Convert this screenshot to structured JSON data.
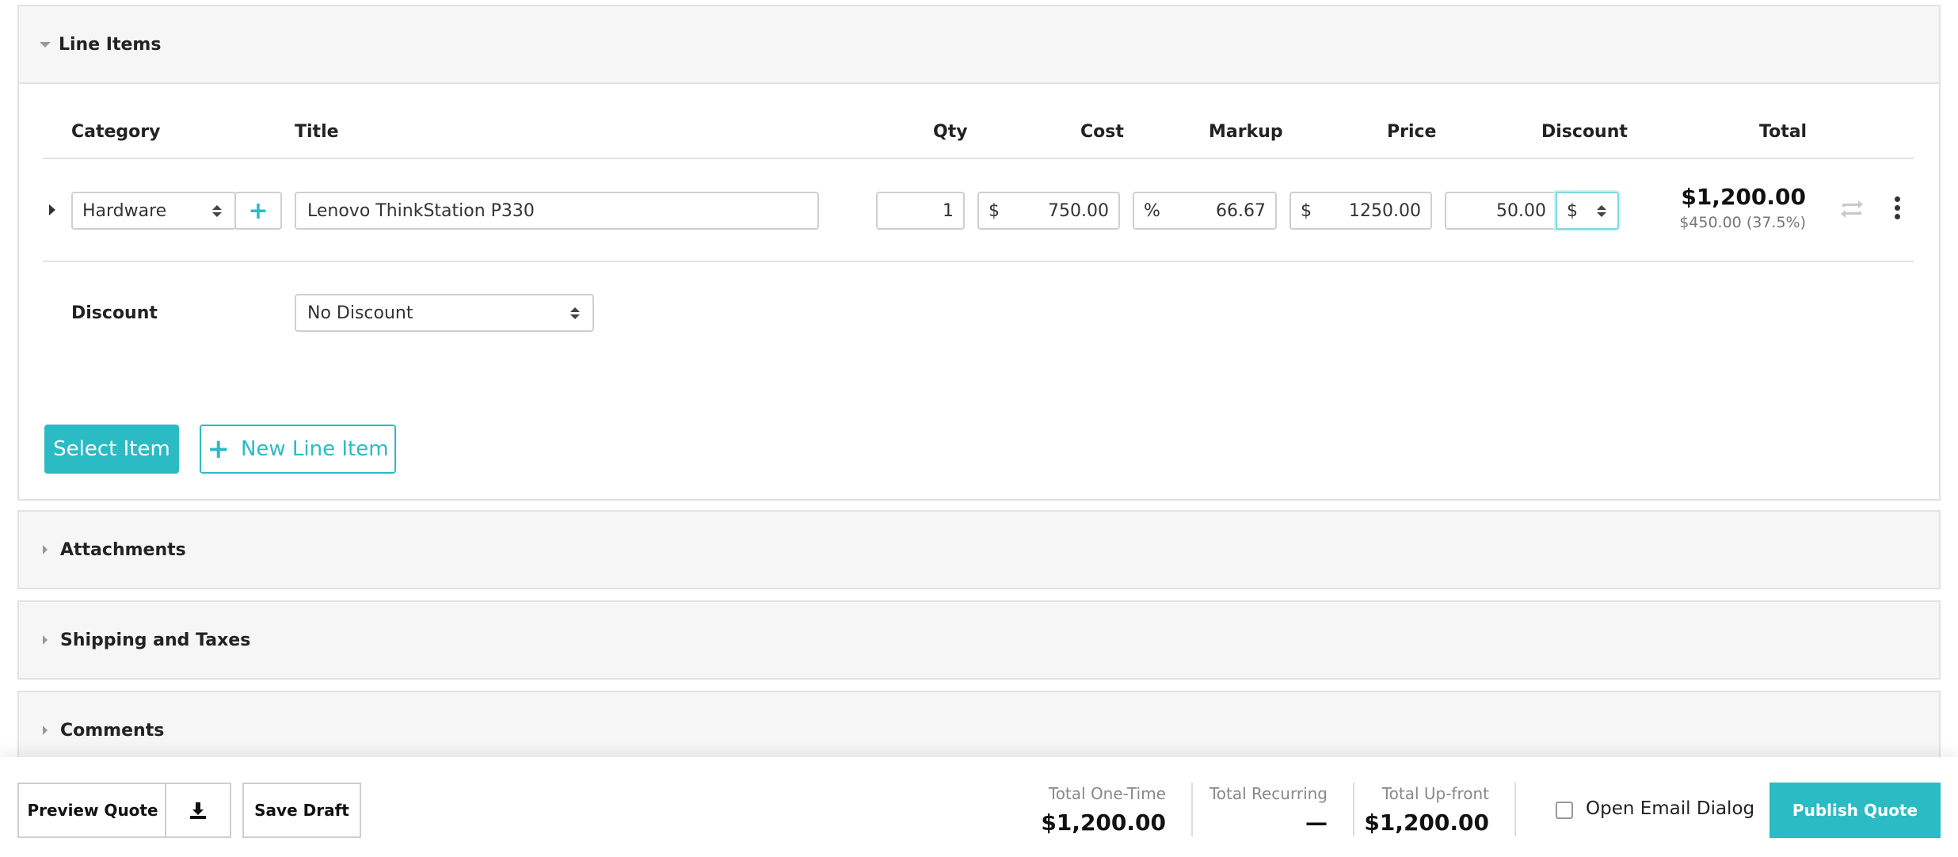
{
  "sections": {
    "line_items": "Line Items",
    "attachments": "Attachments",
    "shipping": "Shipping and Taxes",
    "comments": "Comments"
  },
  "table": {
    "headers": {
      "category": "Category",
      "title": "Title",
      "qty": "Qty",
      "cost": "Cost",
      "markup": "Markup",
      "price": "Price",
      "discount": "Discount",
      "total": "Total"
    },
    "row": {
      "category": "Hardware",
      "title": "Lenovo ThinkStation P330",
      "qty": "1",
      "cost_prefix": "$",
      "cost": "750.00",
      "markup_prefix": "%",
      "markup": "66.67",
      "price_prefix": "$",
      "price": "1250.00",
      "discount": "50.00",
      "discount_type": "$",
      "total": "$1,200.00",
      "total_sub": "$450.00 (37.5%)"
    }
  },
  "discount": {
    "label": "Discount",
    "value": "No Discount"
  },
  "actions": {
    "select_item": "Select Item",
    "new_line_item": "New Line Item"
  },
  "footer": {
    "preview": "Preview Quote",
    "save_draft": "Save Draft",
    "total_one_time_label": "Total One-Time",
    "total_one_time": "$1,200.00",
    "total_recurring_label": "Total Recurring",
    "total_recurring": "—",
    "total_upfront_label": "Total Up-front",
    "total_upfront": "$1,200.00",
    "email_dialog": "Open Email Dialog",
    "publish": "Publish Quote"
  },
  "colors": {
    "accent": "#2bbbc4"
  }
}
